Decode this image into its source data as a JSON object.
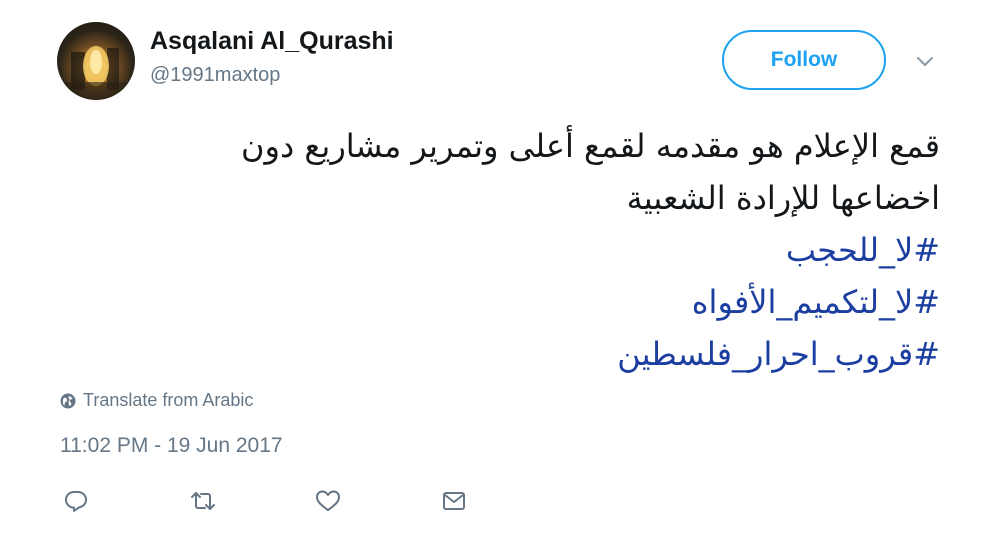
{
  "author": {
    "name": "Asqalani Al_Qurashi",
    "handle": "@1991maxtop"
  },
  "follow_button": {
    "label": "Follow"
  },
  "tweet": {
    "lines": [
      "قمع الإعلام هو مقدمه لقمع أعلى وتمرير مشاريع دون",
      "اخضاعها للإرادة الشعبية"
    ],
    "hashtags": [
      "#لا_للحجب",
      "#لا_لتكميم_الأفواه",
      "#قروب_احرار_فلسطين"
    ]
  },
  "translate": {
    "label": "Translate from Arabic"
  },
  "timestamp": "11:02 PM - 19 Jun 2017",
  "icons": {
    "avatar": "profile-photo",
    "caret": "chevron-down-icon",
    "globe": "globe-icon",
    "reply": "reply-icon",
    "retweet": "retweet-icon",
    "like": "heart-icon",
    "message": "envelope-icon"
  },
  "colors": {
    "brand_blue": "#1da1f2",
    "hashtag": "#1b3ea0",
    "secondary_text": "#657786",
    "primary_text": "#14171a"
  }
}
